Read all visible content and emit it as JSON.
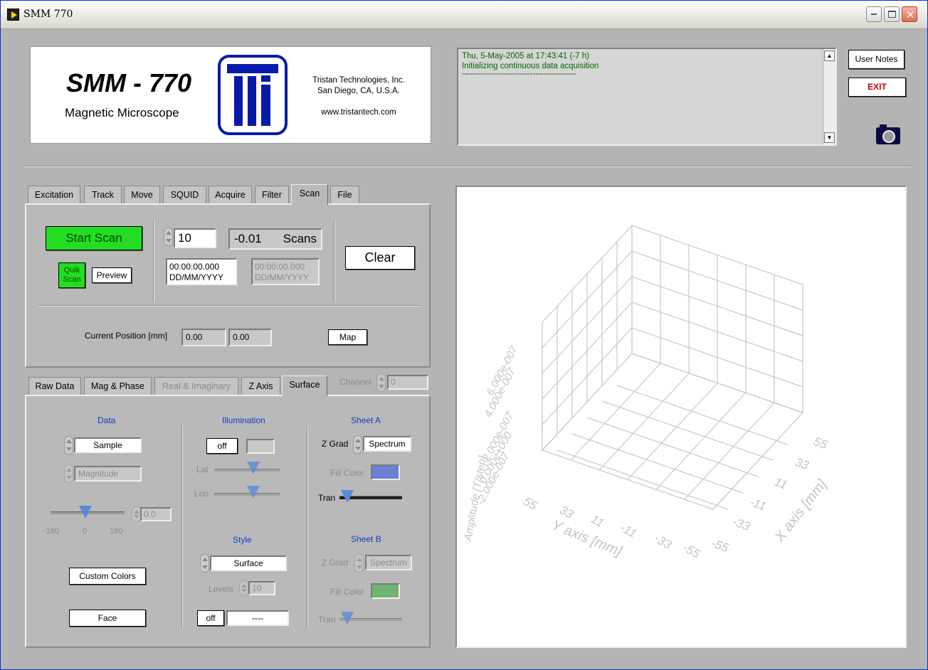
{
  "window": {
    "title": "SMM 770"
  },
  "logo": {
    "product": "SMM - 770",
    "subtitle": "Magnetic Microscope",
    "company_line1": "Tristan Technologies, Inc.",
    "company_line2": "San Diego, CA, U.S.A.",
    "website": "www.tristantech.com"
  },
  "log": {
    "line1": "Thu, 5-May-2005 at 17:43:41 (-7 h)",
    "line2": "Initializing continuous data acquisition",
    "line3": "------------------------------------------"
  },
  "buttons": {
    "user_notes": "User Notes",
    "exit": "EXIT"
  },
  "top_tabs": [
    {
      "label": "Excitation"
    },
    {
      "label": "Track"
    },
    {
      "label": "Move"
    },
    {
      "label": "SQUID"
    },
    {
      "label": "Acquire"
    },
    {
      "label": "Filter"
    },
    {
      "label": "Scan",
      "active": true
    },
    {
      "label": "File"
    }
  ],
  "scan": {
    "start_scan": "Start Scan",
    "quik_scan": "Quik Scan",
    "preview": "Preview",
    "count": "10",
    "scans_value": "-0.01",
    "scans_label": "Scans",
    "time1": "00:00:00.000",
    "date1": "DD/MM/YYYY",
    "time2": "00:00:00.000",
    "date2": "DD/MM/YYYY",
    "clear": "Clear",
    "current_position_label": "Current Position [mm]",
    "pos_x": "0.00",
    "pos_y": "0.00",
    "map": "Map"
  },
  "bottom_tabs": [
    {
      "label": "Raw Data"
    },
    {
      "label": "Mag & Phase"
    },
    {
      "label": "Real & Imaginary",
      "disabled": true
    },
    {
      "label": "Z Axis"
    },
    {
      "label": "Surface",
      "active": true
    }
  ],
  "channel": {
    "label": "Channel",
    "value": "0"
  },
  "surface": {
    "data_header": "Data",
    "data_value": "Sample",
    "data_component": "Magnitude",
    "angle_value": "0.0",
    "angle_ticks": [
      "-180",
      "0",
      "180"
    ],
    "custom_colors": "Custom Colors",
    "face": "Face",
    "illum_header": "Illumination",
    "illum_toggle": "off",
    "lat_label": "Lat",
    "lon_label": "Lon",
    "style_header": "Style",
    "style_value": "Surface",
    "levels_label": "Levels",
    "levels_value": "10",
    "style_toggle": "off",
    "style_extra": "----",
    "sheet_a_header": "Sheet A",
    "sheet_a_zgrad_label": "Z Grad",
    "sheet_a_zgrad": "Spectrum",
    "sheet_a_fill_label": "Fill Color",
    "sheet_a_tran": "Tran",
    "sheet_b_header": "Sheet B",
    "sheet_b_zgrad_label": "Z Grad",
    "sheet_b_zgrad": "Spectrum",
    "sheet_b_fill_label": "Fill Color",
    "sheet_b_tran": "Tran"
  },
  "colors": {
    "sheet_a_fill": "#6b7fd6",
    "sheet_b_fill": "#6fb46f",
    "start_scan_bg": "#22dd22",
    "log_text": "#006600",
    "exit_text": "#cc0000"
  },
  "plot3d": {
    "z_ticks": [
      "-2.000e-007",
      "0.000e+000",
      "2.000e-007",
      "4.000e-007",
      "6.000e-007"
    ],
    "z_label": "Amplitude [T/step]",
    "y_ticks": [
      "55",
      "33",
      "11",
      "-11",
      "-33",
      "-55"
    ],
    "y_label": "Y axis [mm]",
    "x_ticks": [
      "55",
      "33",
      "11",
      "-11",
      "-33",
      "-55"
    ],
    "x_label": "X axis [mm]"
  }
}
